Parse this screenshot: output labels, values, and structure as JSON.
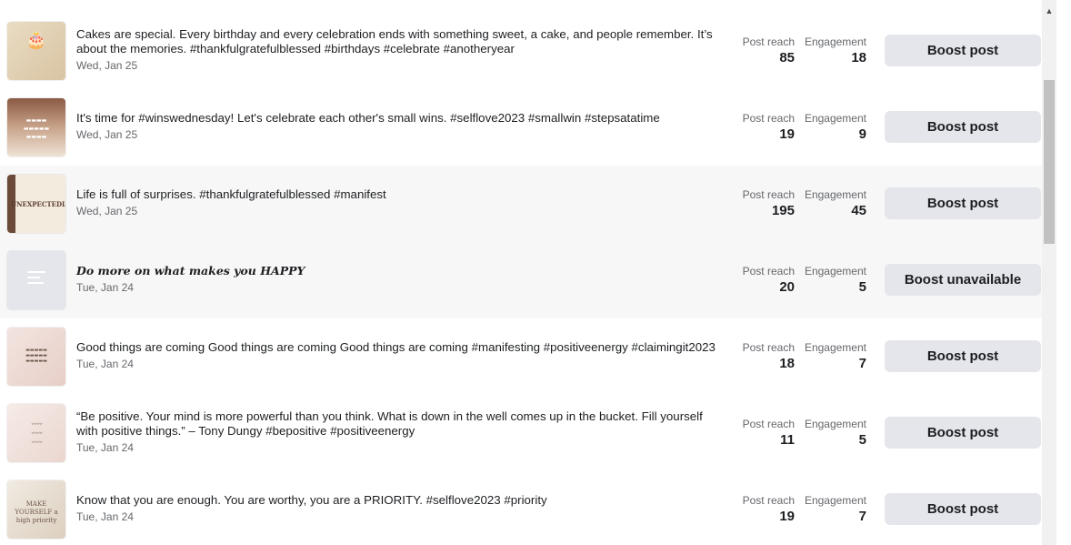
{
  "metric_labels": {
    "reach": "Post reach",
    "engagement": "Engagement"
  },
  "posts": [
    {
      "thumbnail": "birthday-cake-thumbnail",
      "thumb_text": "🎂",
      "caption": "Cakes are special. Every birthday and every celebration ends with something sweet, a cake, and people remember. It’s about the memories. #thankfulgratefulblessed #birthdays #celebrate #anotheryear",
      "date": "Wed, Jan 25",
      "reach": "85",
      "engagement": "18",
      "button": "Boost post"
    },
    {
      "thumbnail": "wins-wednesday-thumbnail",
      "thumb_text": "",
      "caption": "It's time for #winswednesday! Let's celebrate each other's small wins. #selflove2023 #smallwin #stepsatatime",
      "date": "Wed, Jan 25",
      "reach": "19",
      "engagement": "9",
      "button": "Boost post"
    },
    {
      "thumbnail": "surprises-thumbnail",
      "thumb_text": "UNEXPECTEDLY",
      "caption": "Life is full of surprises. #thankfulgratefulblessed #manifest",
      "date": "Wed, Jan 25",
      "reach": "195",
      "engagement": "45",
      "button": "Boost post"
    },
    {
      "thumbnail": "text-post-placeholder",
      "thumb_text": "",
      "caption": "Do more on what makes you HAPPY",
      "date": "Tue, Jan 24",
      "reach": "20",
      "engagement": "5",
      "button": "Boost unavailable"
    },
    {
      "thumbnail": "good-things-thumbnail",
      "thumb_text": "",
      "caption": "Good things are coming Good things are coming Good things are coming #manifesting #positiveenergy #claimingit2023",
      "date": "Tue, Jan 24",
      "reach": "18",
      "engagement": "7",
      "button": "Boost post"
    },
    {
      "thumbnail": "be-positive-thumbnail",
      "thumb_text": "",
      "caption": "“Be positive. Your mind is more powerful than you think. What is down in the well comes up in the bucket. Fill yourself with positive things.” – Tony Dungy #bepositive #positiveenergy",
      "date": "Tue, Jan 24",
      "reach": "11",
      "engagement": "5",
      "button": "Boost post"
    },
    {
      "thumbnail": "priority-thumbnail",
      "thumb_text": "MAKE YOURSELF a high priority",
      "caption": "Know that you are enough. You are worthy, you are a PRIORITY. #selflove2023 #priority",
      "date": "Tue, Jan 24",
      "reach": "19",
      "engagement": "7",
      "button": "Boost post"
    }
  ]
}
